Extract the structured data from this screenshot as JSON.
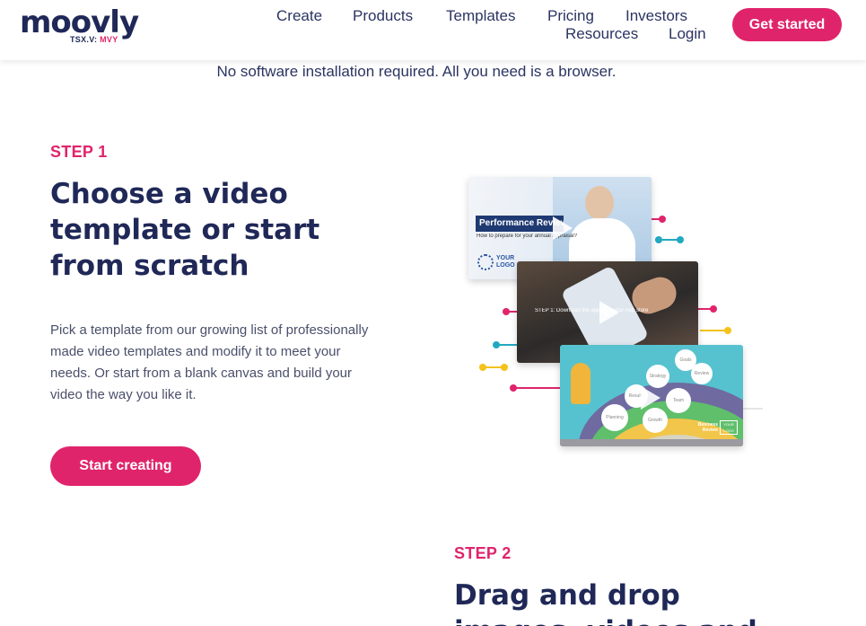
{
  "brand": {
    "name": "moovly",
    "ticker_prefix": "TSX.V:",
    "ticker_symbol": "MVY"
  },
  "nav": {
    "items": [
      "Create",
      "Products",
      "Templates",
      "Pricing",
      "Investors",
      "Resources",
      "Login"
    ],
    "cta": "Get started"
  },
  "tagline": "No software installation required. All you need is a browser.",
  "step1": {
    "label": "STEP 1",
    "title_lines": [
      "Choose a video",
      "template or start",
      "from scratch"
    ],
    "description": "Pick a template from our growing list of professionally made video templates and modify it to meet your needs. Or start from a blank canvas and build your video the way you like it.",
    "button": "Start creating"
  },
  "illustration": {
    "card1_title": "Performance Review",
    "card1_subtitle": "How to prepare for your annual appraisal?",
    "card1_logo": "YOUR LOGO",
    "card2_caption": "STEP 1: Download the app from your App store",
    "card3_caption": "Business Review",
    "card3_logo": "YOUR LOGO",
    "card3_bubbles": [
      "Strategy",
      "Goals",
      "Results",
      "Team",
      "Planning",
      "Growth",
      "Review"
    ]
  },
  "step2": {
    "label": "STEP 2",
    "title_lines": [
      "Drag and drop",
      "images, videos and"
    ]
  },
  "colors": {
    "accent": "#e0246b",
    "navy": "#1f2857",
    "teal": "#22a9c2",
    "yellow": "#f4c21b"
  }
}
